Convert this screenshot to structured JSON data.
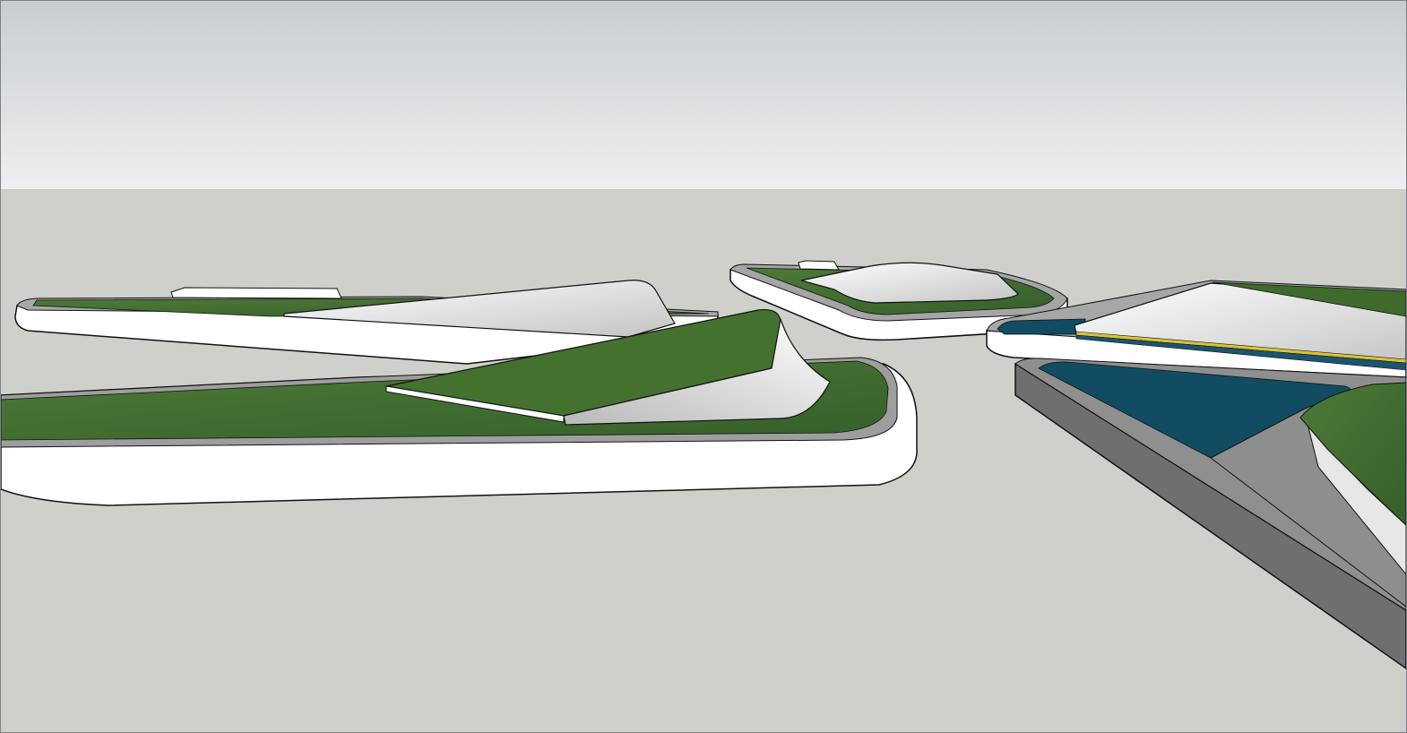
{
  "scene": {
    "kind": "3D modeling viewport",
    "colors": {
      "sky_top": "#c9cdd1",
      "sky_bottom": "#eeeff0",
      "ground": "#cfcfcb",
      "platform_side": "#ffffff",
      "platform_rim": "#9e9e9e",
      "grass": "#3e6a2c",
      "grass_light": "#5b8a43",
      "water": "#124c63",
      "concrete_ramp": "#8e8e8e",
      "dark_slab": "#6f6f6f",
      "edge_line": "#111111"
    },
    "objects": [
      {
        "name": "long-left-platform",
        "material": "grass"
      },
      {
        "name": "front-left-platform",
        "material": "grass"
      },
      {
        "name": "center-back-platform",
        "material": "grass"
      },
      {
        "name": "right-pool-platform",
        "material": "water"
      },
      {
        "name": "right-front-slab",
        "material": "water"
      }
    ]
  }
}
